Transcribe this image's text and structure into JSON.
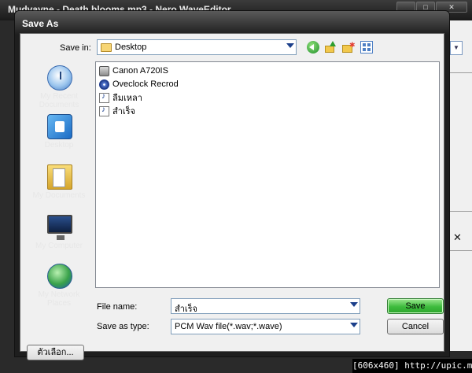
{
  "background_app": {
    "title": "Mudvayne - Death blooms.mp3 - Nero WaveEditor"
  },
  "dialog": {
    "title": "Save As",
    "save_in": {
      "label": "Save in:",
      "value": "Desktop"
    },
    "places": [
      {
        "label": "My Recent\nDocuments",
        "icon": "recent-documents-icon"
      },
      {
        "label": "Desktop",
        "icon": "desktop-icon"
      },
      {
        "label": "My Documents",
        "icon": "my-documents-icon"
      },
      {
        "label": "My Computer",
        "icon": "my-computer-icon"
      },
      {
        "label": "My Network\nPlaces",
        "icon": "network-places-icon"
      }
    ],
    "files": [
      {
        "name": "Canon A720IS",
        "icon": "camera-icon"
      },
      {
        "name": "Oveclock Recrod",
        "icon": "disc-icon"
      },
      {
        "name": "ลืมเหลา",
        "icon": "audio-file-icon"
      },
      {
        "name": "สำเร็จ",
        "icon": "audio-file-icon"
      }
    ],
    "file_name": {
      "label": "File name:",
      "value": "สำเร็จ"
    },
    "save_as_type": {
      "label": "Save as type:",
      "value": "PCM Wav file(*.wav;*.wave)"
    },
    "save_button": "Save",
    "cancel_button": "Cancel",
    "options_button": "ตัวเลือก..."
  },
  "watermark": "[606x460] http://upic.me/",
  "colors": {
    "accent_green": "#3dbb3d",
    "title_dark": "#1e1e1e"
  }
}
